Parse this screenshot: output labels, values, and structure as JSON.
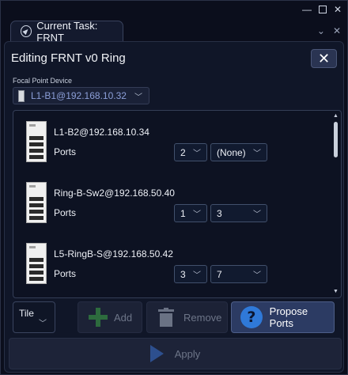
{
  "window": {
    "controls": {
      "minimize": "—",
      "maximize": "",
      "close": "✕"
    }
  },
  "tab": {
    "label": "Current Task: FRNT",
    "icon": "navigation-arrow-icon",
    "tools": {
      "menu": "⌄",
      "close": "✕"
    }
  },
  "panel": {
    "title": "Editing FRNT v0 Ring",
    "close_label": "✕",
    "focal_point": {
      "label": "Focal Point Device",
      "value": "L1-B1@192.168.10.32"
    },
    "devices": [
      {
        "name": "L1-B2@192.168.10.34",
        "ports_label": "Ports",
        "port_number": "2",
        "port_value": "(None)"
      },
      {
        "name": "Ring-B-Sw2@192.168.50.40",
        "ports_label": "Ports",
        "port_number": "1",
        "port_value": "3"
      },
      {
        "name": "L5-RingB-S@192.168.50.42",
        "ports_label": "Ports",
        "port_number": "3",
        "port_value": "7"
      }
    ],
    "layout_select": {
      "value": "Tile"
    },
    "buttons": {
      "add": "Add",
      "remove": "Remove",
      "propose": "Propose Ports",
      "apply": "Apply"
    }
  },
  "colors": {
    "background": "#0b0e1c",
    "accent": "#2f79d8",
    "focal_value": "#8c9fd8",
    "add_icon": "#2d6b3e"
  }
}
